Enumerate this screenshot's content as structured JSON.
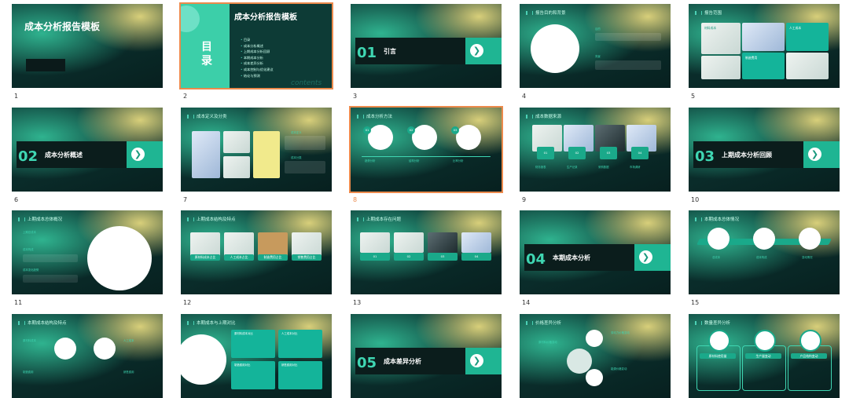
{
  "slides": [
    {
      "number": "1",
      "title": "成本分析报告模板"
    },
    {
      "number": "2",
      "title": "成本分析报告模板",
      "mu": "目",
      "lu": "录",
      "items": [
        "目录",
        "成本分析概述",
        "上期成本分析回顾",
        "本期成本分析",
        "成本差异分析",
        "成本控制与优化建议",
        "结论与预测"
      ],
      "contents": "contents"
    },
    {
      "number": "3",
      "sec_num": "01",
      "sec_text": "引言"
    },
    {
      "number": "4",
      "heading": "报告目的和背景",
      "sub1": "目的",
      "sub2": "背景"
    },
    {
      "number": "5",
      "heading": "报告范围",
      "tags": [
        "材料成本",
        "人工成本",
        "制造费用"
      ]
    },
    {
      "number": "6",
      "sec_num": "02",
      "sec_text": "成本分析概述"
    },
    {
      "number": "7",
      "heading": "成本定义及分类",
      "tags": [
        "成本定义",
        "成本分类"
      ]
    },
    {
      "number": "8",
      "heading": "成本分析方法",
      "steps": [
        "01",
        "02",
        "03"
      ],
      "labels": [
        "趋势分析",
        "结构分析",
        "比率分析"
      ]
    },
    {
      "number": "9",
      "heading": "成本数据来源",
      "cards": [
        "01",
        "02",
        "03",
        "04"
      ],
      "labels": [
        "财务报表",
        "生产记录",
        "采购数据",
        "市场调研"
      ]
    },
    {
      "number": "10",
      "sec_num": "03",
      "sec_text": "上期成本分析回顾"
    },
    {
      "number": "11",
      "heading": "上期成本总体概况",
      "points": [
        "上期总成本",
        "成本构成",
        "成本变化趋势"
      ]
    },
    {
      "number": "12",
      "heading": "上期成本结构及特点",
      "labels": [
        "原材料成本占比",
        "人工成本占比",
        "制造费用占比",
        "销售费用占比"
      ]
    },
    {
      "number": "13",
      "heading": "上期成本存在问题",
      "cards": [
        "01",
        "02",
        "03",
        "04"
      ]
    },
    {
      "number": "14",
      "sec_num": "04",
      "sec_text": "本期成本分析"
    },
    {
      "number": "15",
      "heading": "本期成本总体情况",
      "labels": [
        "总成本",
        "成本构成",
        "变动情况"
      ]
    },
    {
      "number": "16",
      "heading": "本期成本结构及特点",
      "labels": [
        "原材料成本",
        "人工成本",
        "制造费用",
        "销售费用"
      ]
    },
    {
      "number": "17",
      "heading": "本期成本与上期对比",
      "labels": [
        "原材料成本对比",
        "人工成本对比",
        "制造费用对比",
        "销售费用对比"
      ]
    },
    {
      "number": "18",
      "sec_num": "05",
      "sec_text": "成本差异分析"
    },
    {
      "number": "19",
      "heading": "价格差异分析",
      "labels": [
        "原材料价格变动",
        "劳动力价格变动",
        "能源价格变动"
      ]
    },
    {
      "number": "20",
      "heading": "数量差异分析",
      "labels": [
        "原材料使用量",
        "生产量变动",
        "产品结构变动"
      ]
    }
  ],
  "selected": "2",
  "colors": {
    "accent": "#1fb593",
    "selection": "#ec8a4c",
    "slide_bg": "#0b2e2c"
  }
}
